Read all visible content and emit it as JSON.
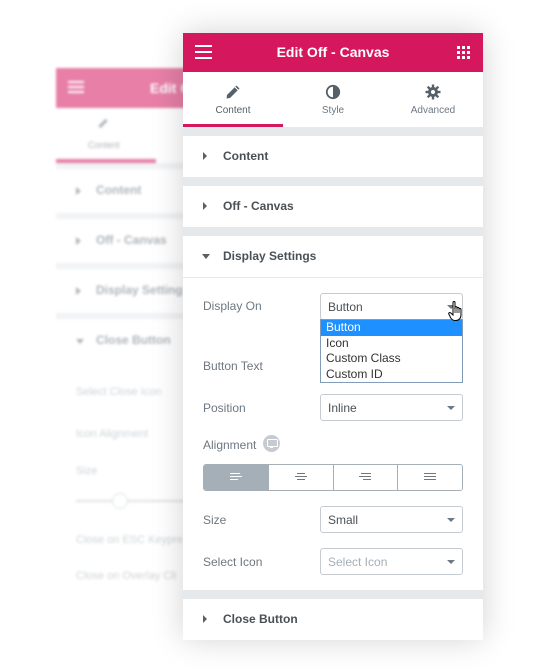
{
  "header": {
    "title": "Edit Off - Canvas",
    "menu_icon": "hamburger-icon",
    "apps_icon": "grid-icon",
    "brand_color": "#d5175e"
  },
  "tabs": [
    {
      "label": "Content",
      "icon": "pencil-icon",
      "active": true
    },
    {
      "label": "Style",
      "icon": "contrast-icon",
      "active": false
    },
    {
      "label": "Advanced",
      "icon": "gear-icon",
      "active": false
    }
  ],
  "sections": {
    "content": "Content",
    "off_canvas": "Off - Canvas",
    "display_settings": "Display Settings",
    "close_button": "Close Button"
  },
  "fields": {
    "display_on": {
      "label": "Display On",
      "value": "Button",
      "options": [
        "Button",
        "Icon",
        "Custom Class",
        "Custom ID"
      ],
      "highlighted": "Button"
    },
    "button_text": {
      "label": "Button Text"
    },
    "position": {
      "label": "Position",
      "value": "Inline"
    },
    "alignment": {
      "label": "Alignment",
      "options": [
        "left",
        "center",
        "right",
        "justify"
      ],
      "value": "left"
    },
    "size": {
      "label": "Size",
      "value": "Small"
    },
    "select_icon": {
      "label": "Select Icon",
      "placeholder": "Select Icon"
    }
  },
  "background_panel": {
    "title": "Edit O",
    "tab": "Content",
    "sections": [
      "Content",
      "Off - Canvas",
      "Display Setting",
      "Close Button"
    ],
    "lines": [
      "Select Close Icon",
      "Icon Alignment",
      "Size",
      "Close on ESC Keypre",
      "Close on Overlay Cli"
    ],
    "slider_value_fraction": 0.3
  }
}
